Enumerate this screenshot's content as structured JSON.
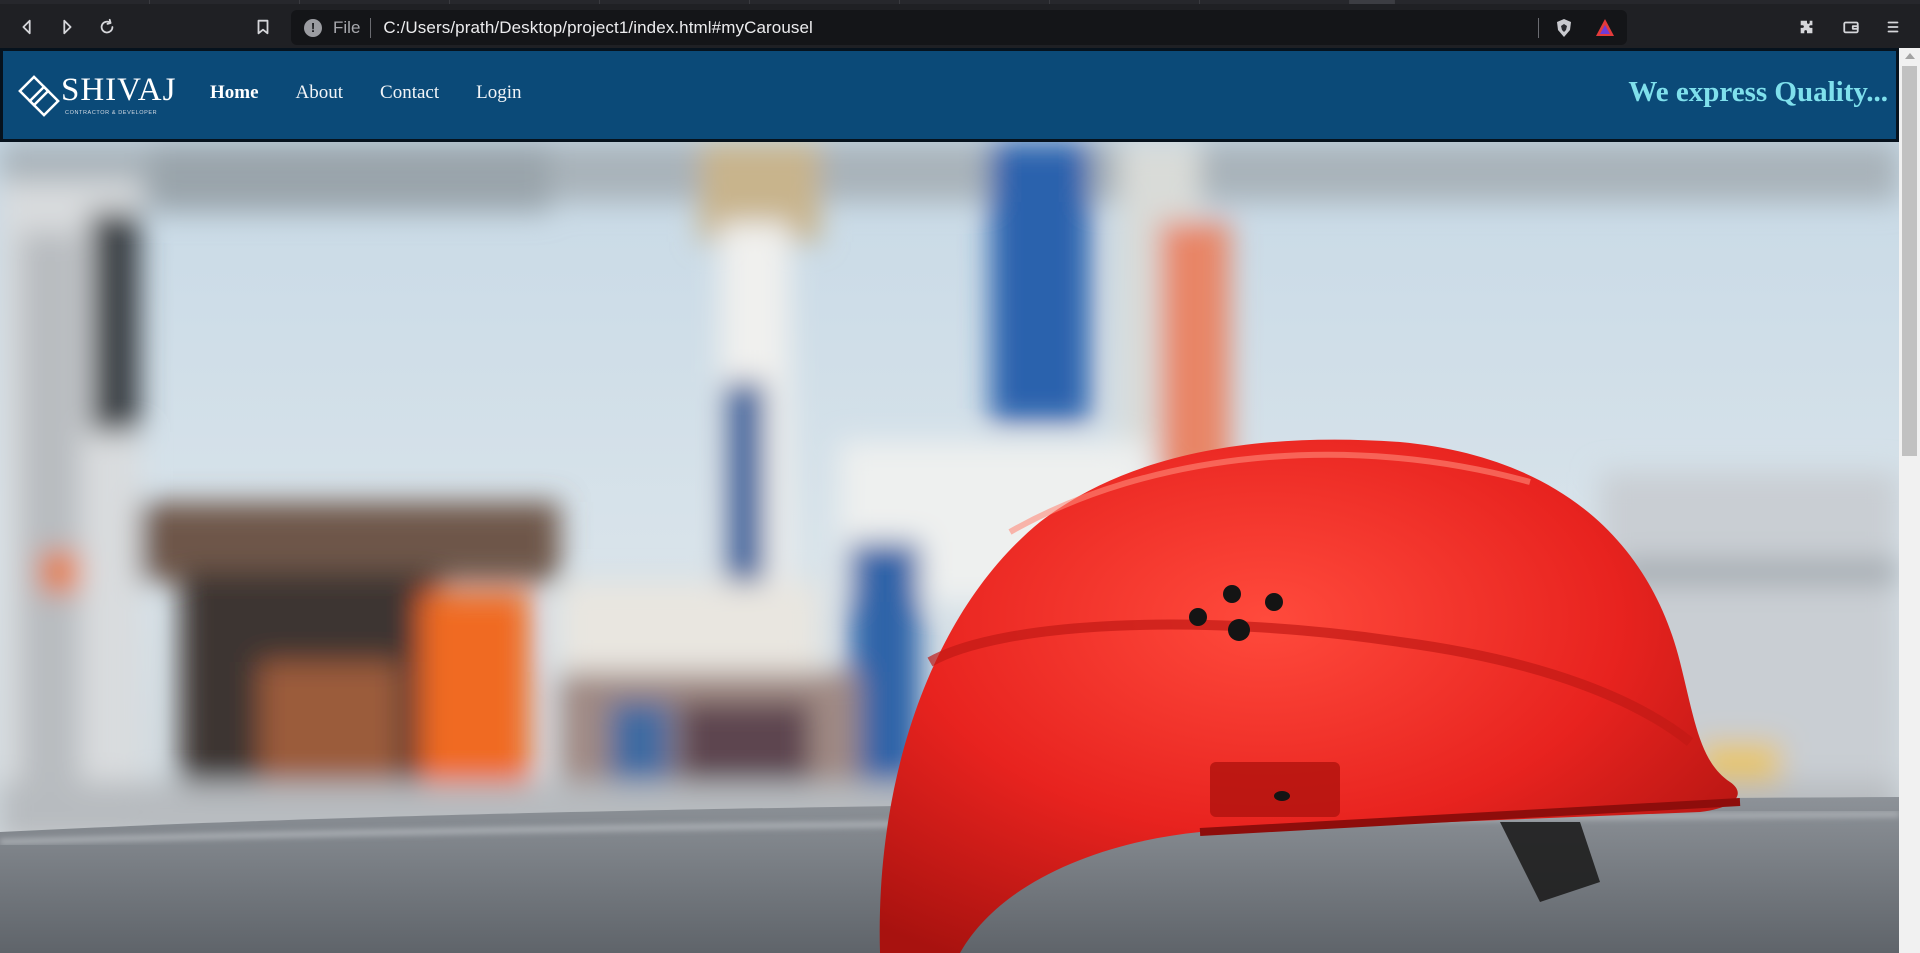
{
  "browser": {
    "url_scheme_label": "File",
    "url": "C:/Users/prath/Desktop/project1/index.html#myCarousel",
    "icons": [
      "back-icon",
      "forward-icon",
      "reload-icon",
      "bookmark-icon",
      "site-info-icon",
      "brave-shields-icon",
      "brave-rewards-icon",
      "extensions-icon",
      "wallet-icon",
      "menu-icon"
    ]
  },
  "site": {
    "brand": {
      "name": "SHIVAJ",
      "subtitle": "CONTRACTOR & DEVELOPER"
    },
    "nav": [
      {
        "label": "Home",
        "active": true
      },
      {
        "label": "About",
        "active": false
      },
      {
        "label": "Contact",
        "active": false
      },
      {
        "label": "Login",
        "active": false
      }
    ],
    "tagline": "We express Quality...",
    "colors": {
      "navbar": "#0b4a78",
      "tagline": "#7fe0ec",
      "helmet": "#e8231f"
    }
  }
}
